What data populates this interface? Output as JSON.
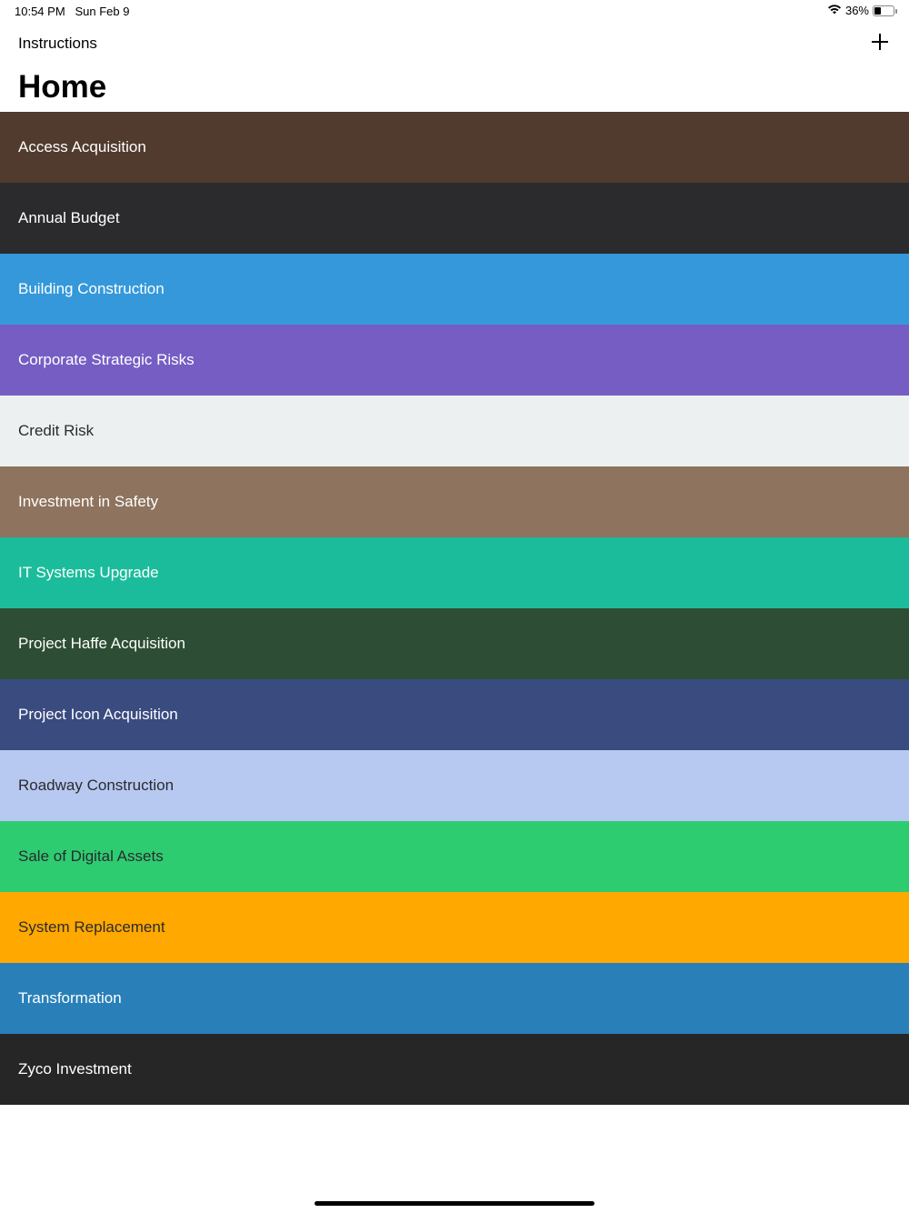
{
  "status_bar": {
    "time": "10:54 PM",
    "date": "Sun Feb 9",
    "battery": "36%",
    "battery_level": 0.36
  },
  "nav": {
    "left_button": "Instructions",
    "title": "Home"
  },
  "items": [
    {
      "label": "Access Acquisition",
      "color": "#513b2e",
      "text_color": "#ffffff"
    },
    {
      "label": "Annual Budget",
      "color": "#2b2b2d",
      "text_color": "#ffffff"
    },
    {
      "label": "Building Construction",
      "color": "#3498db",
      "text_color": "#ffffff"
    },
    {
      "label": "Corporate Strategic Risks",
      "color": "#765dc4",
      "text_color": "#ffffff"
    },
    {
      "label": "Credit Risk",
      "color": "#ecf0f1",
      "text_color": "#2b2b2d"
    },
    {
      "label": "Investment in Safety",
      "color": "#8e735e",
      "text_color": "#ffffff"
    },
    {
      "label": "IT Systems Upgrade",
      "color": "#1bbc9b",
      "text_color": "#ffffff"
    },
    {
      "label": "Project Haffe Acquisition",
      "color": "#2d4e34",
      "text_color": "#ffffff"
    },
    {
      "label": "Project Icon Acquisition",
      "color": "#3a4b80",
      "text_color": "#ffffff"
    },
    {
      "label": "Roadway Construction",
      "color": "#b7c9f1",
      "text_color": "#2b2b2d"
    },
    {
      "label": "Sale of Digital Assets",
      "color": "#2ecc71",
      "text_color": "#2b2b2d"
    },
    {
      "label": "System Replacement",
      "color": "#ffa800",
      "text_color": "#2b2b2d"
    },
    {
      "label": "Transformation",
      "color": "#2980b9",
      "text_color": "#ffffff"
    },
    {
      "label": "Zyco Investment",
      "color": "#262626",
      "text_color": "#ffffff"
    }
  ]
}
